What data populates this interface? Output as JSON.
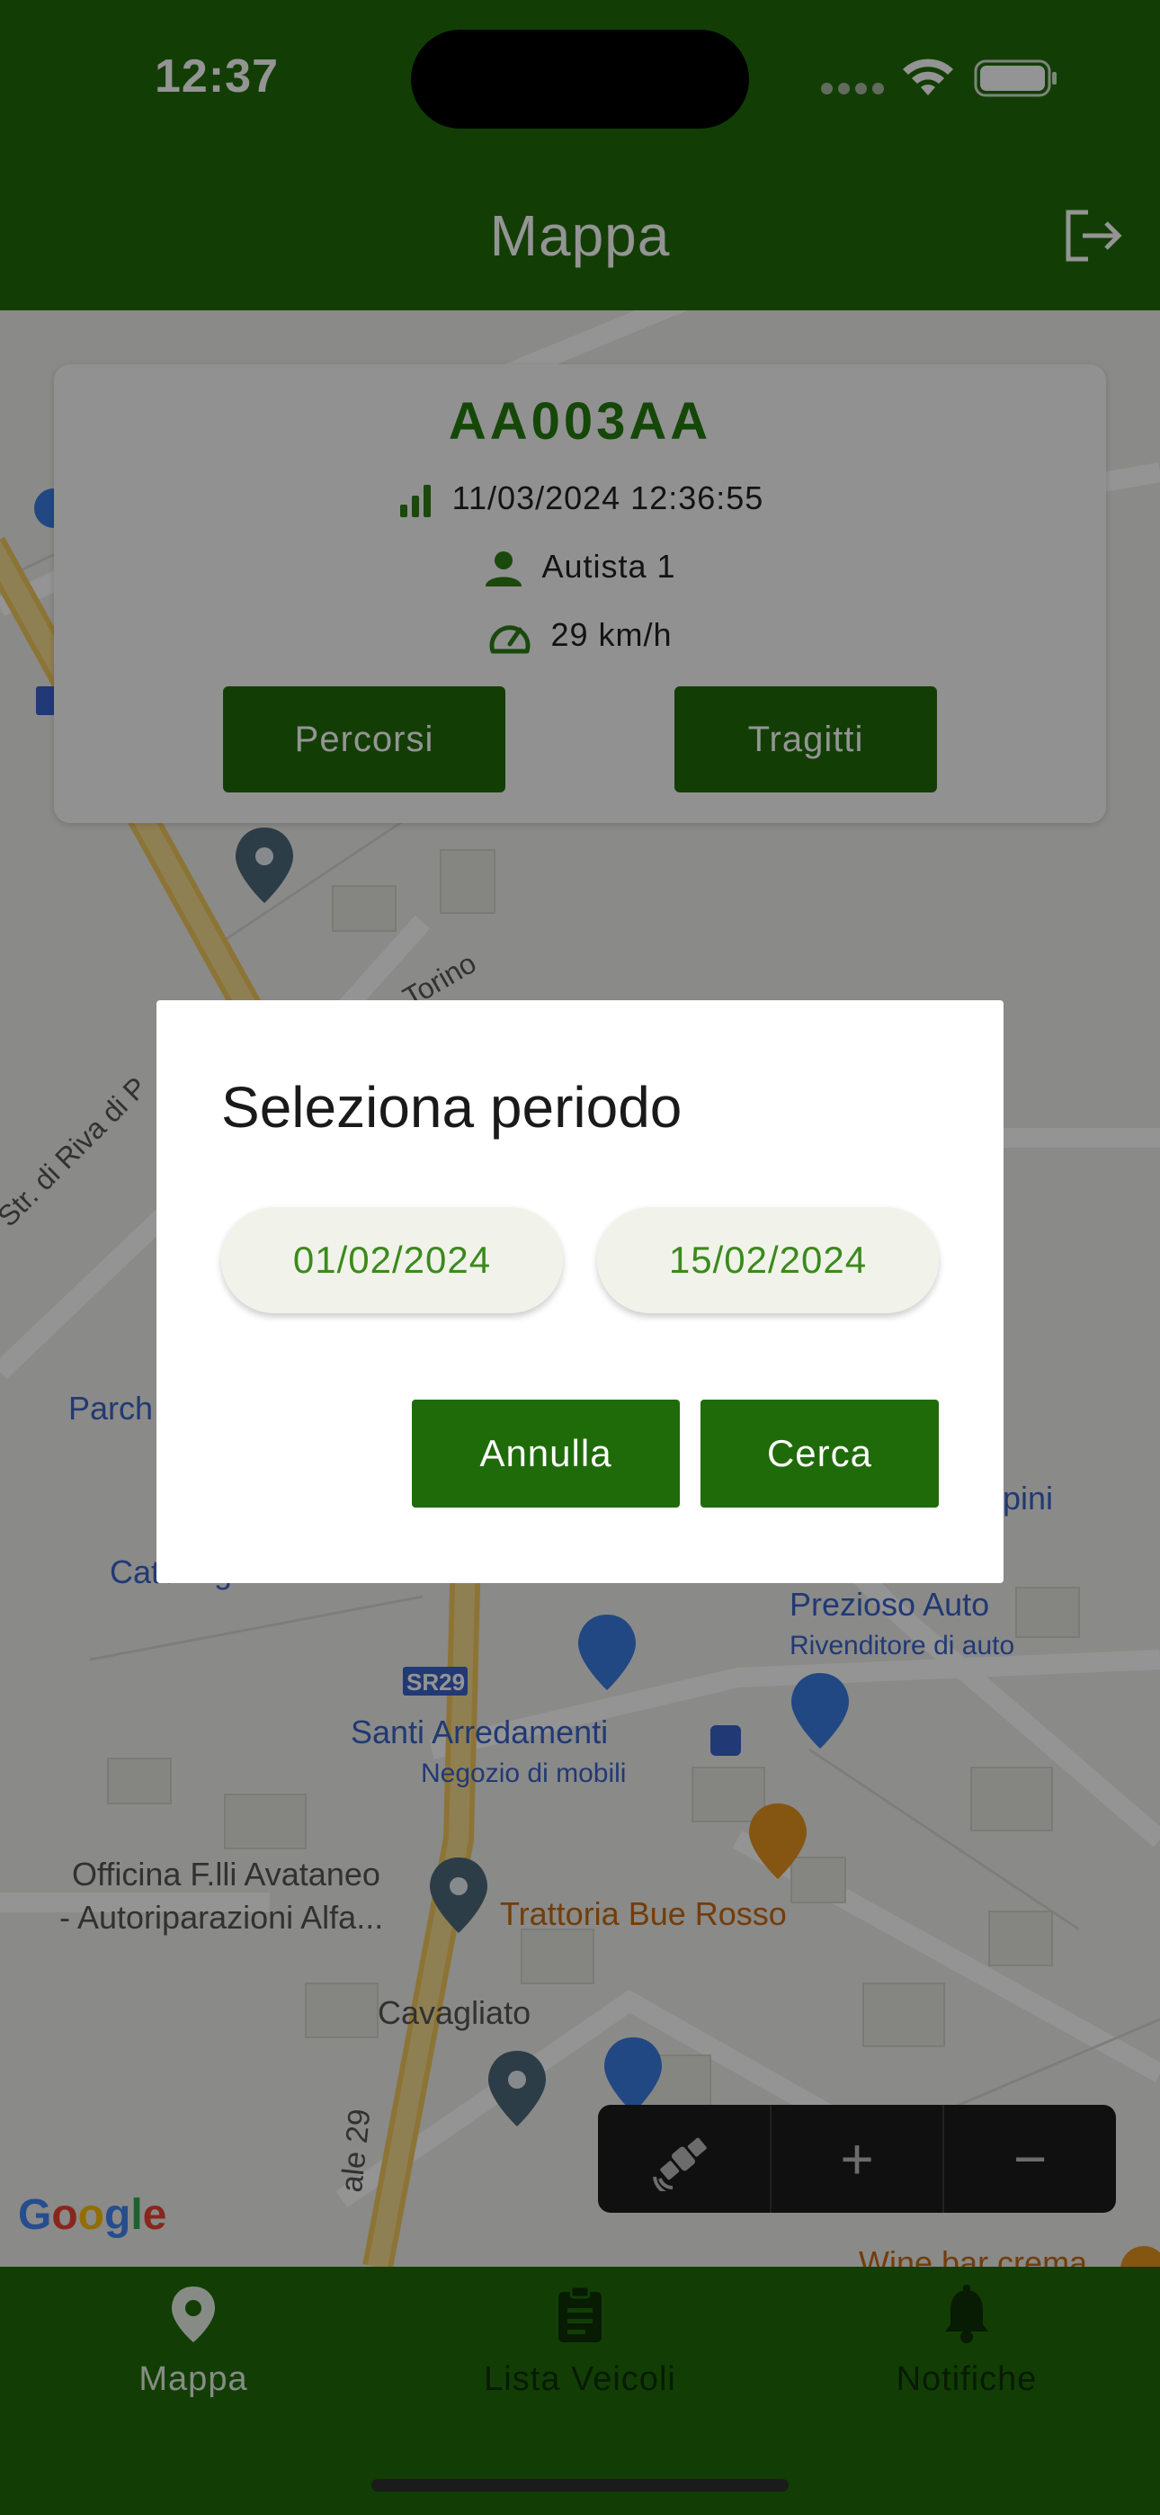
{
  "status_bar": {
    "time": "12:37"
  },
  "header": {
    "title": "Mappa",
    "logout_icon": "logout-icon"
  },
  "vehicle": {
    "plate": "AA003AA",
    "last_update": "11/03/2024 12:36:55",
    "driver": "Autista 1",
    "speed": "29 km/h",
    "percorsi_label": "Percorsi",
    "tragitti_label": "Tragitti"
  },
  "map": {
    "labels": {
      "via_torino": "Via Torino",
      "str_riva": "Str. di Riva di P",
      "parch": "Parch",
      "catering": "Catering",
      "pini": "pini",
      "prezioso": "Prezioso Auto",
      "prezioso_sub": "Rivenditore di auto",
      "sr29": "SR29",
      "santi": "Santi Arredamenti",
      "santi_sub": "Negozio di mobili",
      "officina1": "Officina F.lli Avataneo",
      "officina2": "- Autoriparazioni Alfa...",
      "trattoria": "Trattoria Bue Rosso",
      "cavagliato": "Cavagliato",
      "viale29": "ale 29",
      "winebar": "Wine bar crema"
    },
    "google": "Google",
    "controls": {
      "plus": "+",
      "minus": "−"
    }
  },
  "dialog": {
    "title": "Seleziona periodo",
    "start_date": "01/02/2024",
    "end_date": "15/02/2024",
    "cancel_label": "Annulla",
    "search_label": "Cerca"
  },
  "tabbar": {
    "mappa": "Mappa",
    "lista": "Lista Veicoli",
    "notifiche": "Notifiche"
  },
  "colors": {
    "primary": "#1f6b09",
    "accent_text": "#3b8a1c"
  }
}
